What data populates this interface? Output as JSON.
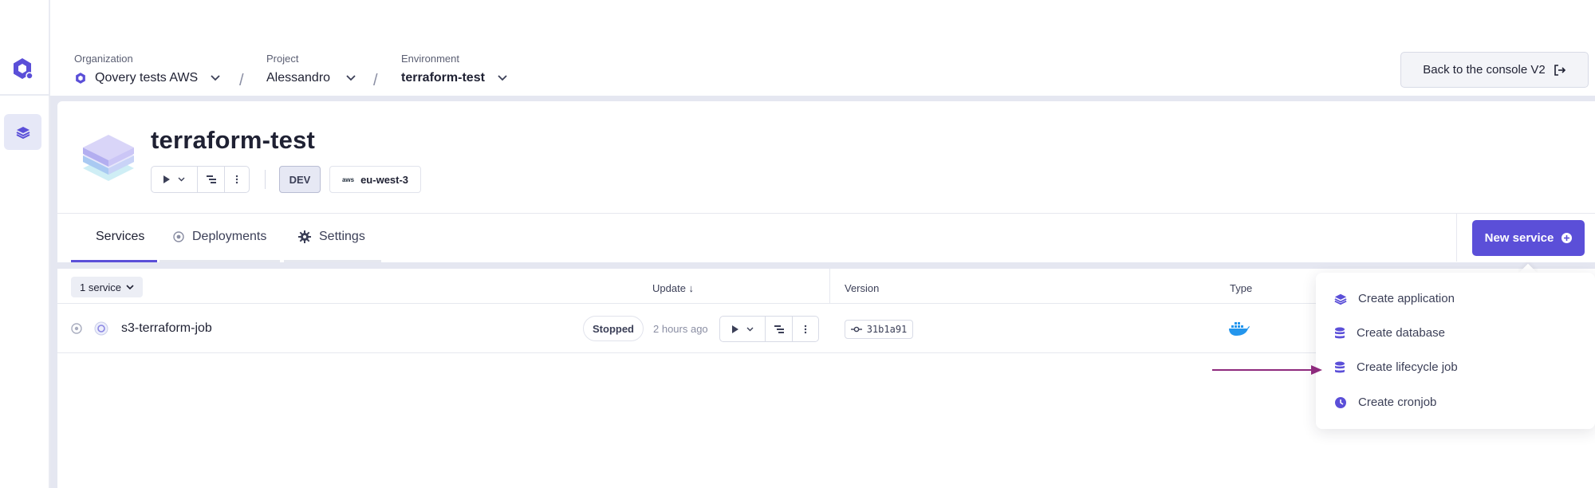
{
  "breadcrumbs": {
    "organization": {
      "label": "Organization",
      "value": "Qovery tests AWS"
    },
    "project": {
      "label": "Project",
      "value": "Alessandro"
    },
    "environment": {
      "label": "Environment",
      "value": "terraform-test"
    },
    "separator": "/"
  },
  "back_button": {
    "label": "Back to the console V2"
  },
  "environment": {
    "title": "terraform-test",
    "mode_badge": "DEV",
    "cloud_badge": "aws",
    "region": "eu-west-3"
  },
  "tabs": [
    {
      "label": "Services",
      "active": true
    },
    {
      "label": "Deployments",
      "active": false
    },
    {
      "label": "Settings",
      "active": false
    }
  ],
  "new_service_button": {
    "label": "New service"
  },
  "table": {
    "count": "1 service",
    "columns": {
      "update": "Update ↓",
      "version": "Version",
      "type": "Type"
    },
    "rows": [
      {
        "name": "s3-terraform-job",
        "status": "Stopped",
        "updated": "2 hours ago",
        "commit": "31b1a91",
        "type_icon": "docker-icon"
      }
    ]
  },
  "dropdown": {
    "items": [
      {
        "label": "Create application",
        "icon": "layers-icon"
      },
      {
        "label": "Create database",
        "icon": "database-icon"
      },
      {
        "label": "Create lifecycle job",
        "icon": "database-icon"
      },
      {
        "label": "Create cronjob",
        "icon": "clock-icon"
      }
    ]
  },
  "colors": {
    "accent": "#5b4fd8",
    "annotation_arrow": "#8e2a7d",
    "background": "#e5e7f1"
  }
}
